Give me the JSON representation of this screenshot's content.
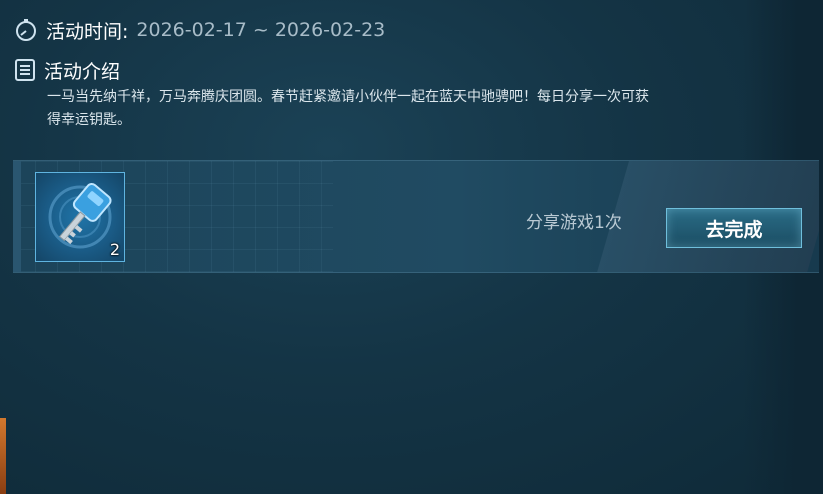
{
  "activity": {
    "time_label": "活动时间:",
    "time_value": "2026-02-17 ~ 2026-02-23",
    "intro_label": "活动介绍",
    "description": "一马当先纳千祥，万马奔腾庆团圆。春节赶紧邀请小伙伴一起在蓝天中驰骋吧！每日分享一次可获得幸运钥匙。"
  },
  "task": {
    "reward_icon": "blue-key-icon",
    "reward_count": "2",
    "description": "分享游戏1次",
    "button_label": "去完成"
  },
  "colors": {
    "background": "#143445",
    "card": "#204b62",
    "button": "#2a6c86",
    "button_border": "#6fbfdc",
    "key_blue": "#3aa0e0"
  }
}
